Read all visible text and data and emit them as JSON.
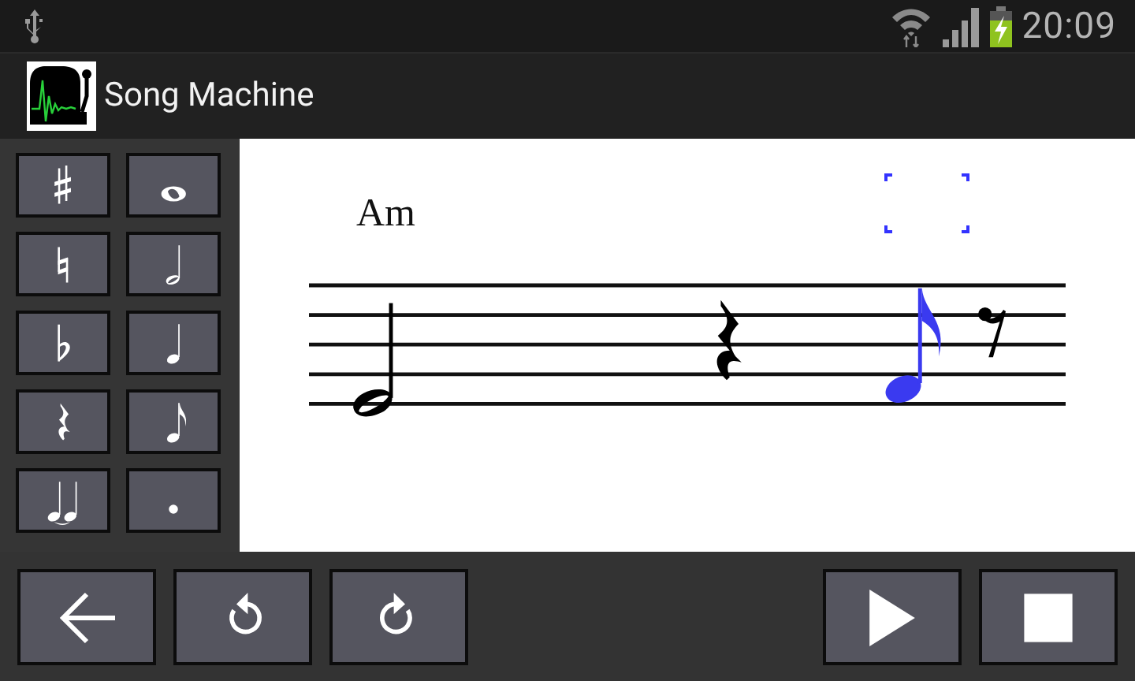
{
  "status_bar": {
    "time": "20:09",
    "battery_charging": true
  },
  "app_bar": {
    "title": "Song Machine"
  },
  "palette": [
    {
      "kind": "sharp"
    },
    {
      "kind": "whole"
    },
    {
      "kind": "natural"
    },
    {
      "kind": "half"
    },
    {
      "kind": "flat"
    },
    {
      "kind": "quarter"
    },
    {
      "kind": "quarter-rest"
    },
    {
      "kind": "eighth"
    },
    {
      "kind": "tie"
    },
    {
      "kind": "dot"
    }
  ],
  "score": {
    "chord": "Am",
    "notes": [
      {
        "kind": "half",
        "selected": false
      },
      {
        "kind": "quarter-rest",
        "selected": false
      },
      {
        "kind": "eighth",
        "selected": true
      },
      {
        "kind": "eighth-rest",
        "selected": false
      }
    ]
  },
  "toolbar": {
    "left": [
      {
        "kind": "back"
      },
      {
        "kind": "undo"
      },
      {
        "kind": "redo"
      }
    ],
    "right": [
      {
        "kind": "play"
      },
      {
        "kind": "stop"
      }
    ]
  }
}
